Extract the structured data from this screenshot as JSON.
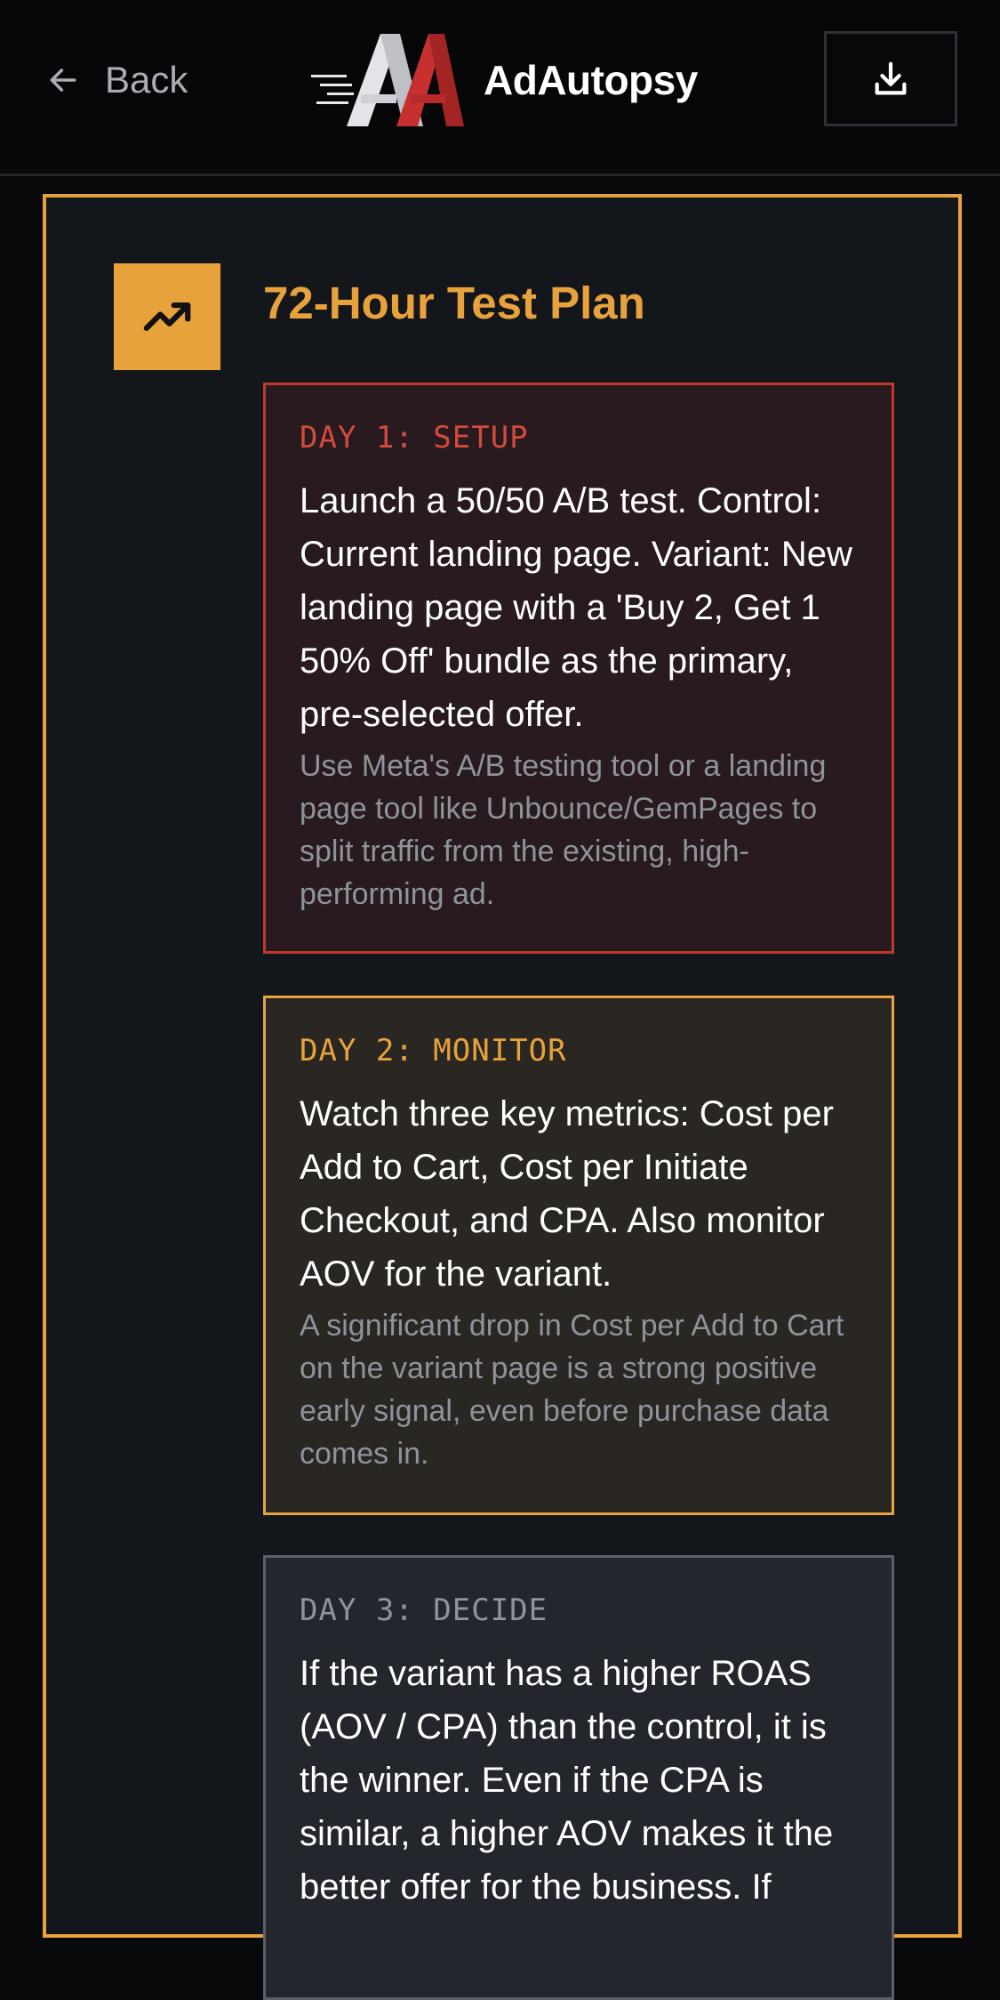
{
  "header": {
    "back_label": "Back",
    "brand_name": "AdAutopsy",
    "icons": {
      "back": "arrow-left-icon",
      "download": "download-icon",
      "logo": "adautopsy-logo"
    }
  },
  "card": {
    "title": "72-Hour Test Plan",
    "icon": "trending-up-icon",
    "days": [
      {
        "label": "DAY 1: SETUP",
        "main": "Launch a 50/50 A/B test. Control: Current landing page. Variant: New landing page with a 'Buy 2, Get 1 50% Off' bundle as the primary, pre-selected offer.",
        "note": "Use Meta's A/B testing tool or a landing page tool like Unbounce/GemPages to split traffic from the existing, high-performing ad."
      },
      {
        "label": "DAY 2: MONITOR",
        "main": "Watch three key metrics: Cost per Add to Cart, Cost per Initiate Checkout, and CPA. Also monitor AOV for the variant.",
        "note": "A significant drop in Cost per Add to Cart on the variant page is a strong positive early signal, even before purchase data comes in."
      },
      {
        "label": "DAY 3: DECIDE",
        "main": "If the variant has a higher ROAS (AOV / CPA) than the control, it is the winner. Even if the CPA is similar, a higher AOV makes it the better offer for the business. If",
        "note": ""
      }
    ]
  },
  "colors": {
    "accent": "#e8a23c",
    "day1_border": "#c0392b",
    "day2_border": "#e8a23c",
    "day3_border": "#5a606a",
    "background": "#08090b",
    "card_background": "#13161b"
  }
}
